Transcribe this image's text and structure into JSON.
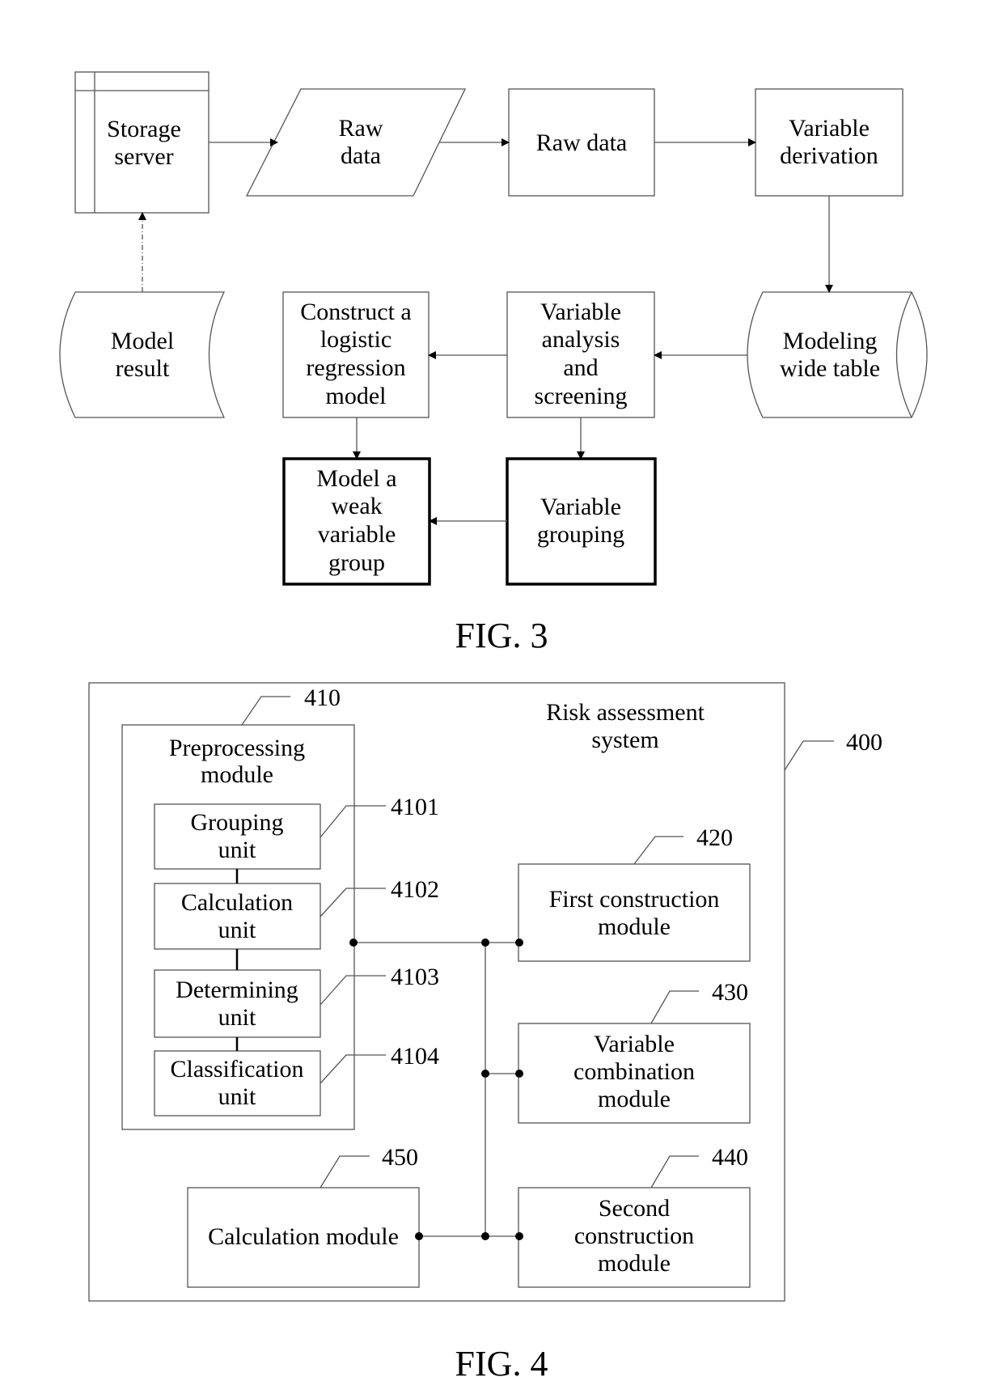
{
  "fig3": {
    "caption": "FIG. 3",
    "nodes": {
      "storage_server": [
        "Storage",
        "server"
      ],
      "raw_data_input": [
        "Raw",
        "data"
      ],
      "raw_data": [
        "Raw data"
      ],
      "variable_derivation": [
        "Variable",
        "derivation"
      ],
      "modeling_wide_table": [
        "Modeling",
        "wide table"
      ],
      "variable_analysis": [
        "Variable",
        "analysis",
        "and",
        "screening"
      ],
      "construct_lr": [
        "Construct a",
        "logistic",
        "regression",
        "model"
      ],
      "model_result": [
        "Model",
        "result"
      ],
      "variable_grouping": [
        "Variable",
        "grouping"
      ],
      "model_weak_group": [
        "Model a",
        "weak",
        "variable",
        "group"
      ]
    }
  },
  "fig4": {
    "caption": "FIG. 4",
    "system": {
      "title": [
        "Risk assessment",
        "system"
      ],
      "ref": "400"
    },
    "preprocessing": {
      "title": [
        "Preprocessing",
        "module"
      ],
      "ref": "410",
      "units": [
        {
          "label": [
            "Grouping",
            "unit"
          ],
          "ref": "4101"
        },
        {
          "label": [
            "Calculation",
            "unit"
          ],
          "ref": "4102"
        },
        {
          "label": [
            "Determining",
            "unit"
          ],
          "ref": "4103"
        },
        {
          "label": [
            "Classification",
            "unit"
          ],
          "ref": "4104"
        }
      ]
    },
    "first_construction": {
      "label": [
        "First construction",
        "module"
      ],
      "ref": "420"
    },
    "variable_combination": {
      "label": [
        "Variable",
        "combination",
        "module"
      ],
      "ref": "430"
    },
    "second_construction": {
      "label": [
        "Second",
        "construction",
        "module"
      ],
      "ref": "440"
    },
    "calculation_module": {
      "label": [
        "Calculation module"
      ],
      "ref": "450"
    }
  }
}
